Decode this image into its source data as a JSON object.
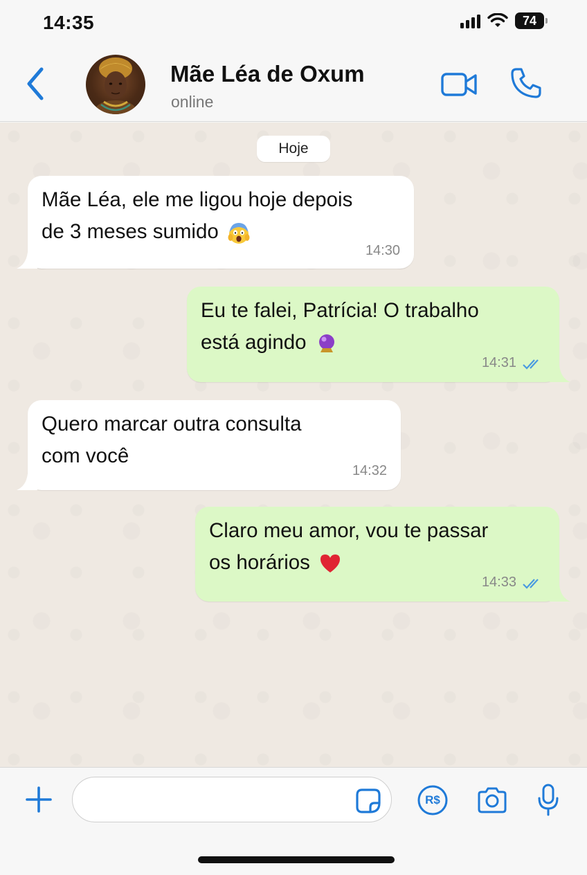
{
  "status_bar": {
    "time": "14:35",
    "battery": "74"
  },
  "header": {
    "contact_name": "Mãe Léa de Oxum",
    "contact_status": "online",
    "icons": [
      "back-icon",
      "avatar",
      "video-icon",
      "phone-icon"
    ]
  },
  "chat": {
    "date_label": "Hoje",
    "messages": [
      {
        "direction": "in",
        "line1": "Mãe Léa, ele me ligou hoje depois",
        "line2": "de 3 meses sumido",
        "emoji": "face-screaming-in-fear",
        "time": "14:30"
      },
      {
        "direction": "out",
        "line1": "Eu te falei, Patrícia! O trabalho",
        "line2": "está agindo",
        "emoji": "crystal-ball",
        "time": "14:31",
        "read": true
      },
      {
        "direction": "in",
        "line1": "Quero marcar outra consulta",
        "line2": "com você",
        "time": "14:32"
      },
      {
        "direction": "out",
        "line1": "Claro meu amor, vou te passar",
        "line2": "os horários",
        "emoji": "red-heart",
        "time": "14:33",
        "read": true
      }
    ]
  },
  "input_bar": {
    "placeholder": "",
    "icons": [
      "plus-icon",
      "sticker-icon",
      "pix-icon",
      "camera-icon",
      "mic-icon"
    ],
    "pix_label": "R$"
  },
  "colors": {
    "accent": "#1f7ad8",
    "incoming_bubble": "#ffffff",
    "outgoing_bubble": "#dcf8c6",
    "chat_background": "#efe9e2"
  }
}
